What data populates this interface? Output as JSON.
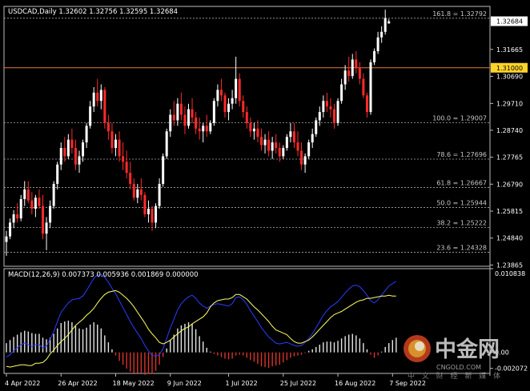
{
  "chart_data": {
    "type": "candlestick",
    "symbol_header": "USDCAD,Daily  1.32602 1.32756 1.32595 1.32684",
    "colors": {
      "up": "#ffffff",
      "down": "#ff2a2a",
      "background": "#000000",
      "grid_dotted": "#aaaaaa",
      "resistance": "#e07a3a",
      "macd_line": "#2b3cff",
      "signal_line": "#ffff66",
      "hist_positive": "#e6e6e6",
      "hist_negative": "#d8342a",
      "current_price_box": "#ffffff",
      "level_box": "#ffd42a"
    },
    "price_axis": {
      "ylim": [
        1.2382,
        1.3322
      ],
      "ticks": [
        "1.31665",
        "1.30690",
        "1.29710",
        "1.28740",
        "1.27765",
        "1.26790",
        "1.25815",
        "1.24840",
        "1.23865"
      ]
    },
    "current_price": "1.32684",
    "horizontal_level": {
      "value": 1.31,
      "label": "1.31000"
    },
    "fibonacci": [
      {
        "label": "161.8 = 1.32792",
        "value": 1.32792
      },
      {
        "label": "100.0 = 1.29007",
        "value": 1.29007
      },
      {
        "label": "78.6 = 1.27696",
        "value": 1.27696
      },
      {
        "label": "61.8 = 1.26667",
        "value": 1.26667
      },
      {
        "label": "50.0 = 1.25944",
        "value": 1.25944
      },
      {
        "label": "38.2 = 1.25222",
        "value": 1.25222
      },
      {
        "label": "23.6 = 1.24328",
        "value": 1.24328
      }
    ],
    "x_labels": [
      "4 Apr 2022",
      "26 Apr 2022",
      "18 May 2022",
      "9 Jun 2022",
      "1 Jul 2022",
      "25 Jul 2022",
      "16 Aug 2022",
      "7 Sep 2022"
    ],
    "candles": [
      [
        1.247,
        1.251,
        1.242,
        1.249
      ],
      [
        1.249,
        1.2555,
        1.248,
        1.254
      ],
      [
        1.254,
        1.2585,
        1.252,
        1.257
      ],
      [
        1.257,
        1.261,
        1.254,
        1.2555
      ],
      [
        1.2555,
        1.264,
        1.2545,
        1.2625
      ],
      [
        1.2625,
        1.269,
        1.26,
        1.266
      ],
      [
        1.266,
        1.269,
        1.261,
        1.262
      ],
      [
        1.262,
        1.265,
        1.257,
        1.259
      ],
      [
        1.259,
        1.264,
        1.256,
        1.263
      ],
      [
        1.263,
        1.266,
        1.259,
        1.26
      ],
      [
        1.26,
        1.264,
        1.248,
        1.25
      ],
      [
        1.25,
        1.256,
        1.244,
        1.254
      ],
      [
        1.254,
        1.262,
        1.252,
        1.26
      ],
      [
        1.26,
        1.269,
        1.259,
        1.268
      ],
      [
        1.268,
        1.276,
        1.266,
        1.275
      ],
      [
        1.275,
        1.283,
        1.273,
        1.281
      ],
      [
        1.281,
        1.285,
        1.276,
        1.278
      ],
      [
        1.278,
        1.286,
        1.277,
        1.284
      ],
      [
        1.284,
        1.288,
        1.279,
        1.281
      ],
      [
        1.281,
        1.284,
        1.273,
        1.275
      ],
      [
        1.275,
        1.28,
        1.272,
        1.278
      ],
      [
        1.278,
        1.284,
        1.276,
        1.283
      ],
      [
        1.283,
        1.29,
        1.281,
        1.289
      ],
      [
        1.289,
        1.298,
        1.288,
        1.296
      ],
      [
        1.296,
        1.303,
        1.294,
        1.301
      ],
      [
        1.301,
        1.306,
        1.296,
        1.298
      ],
      [
        1.298,
        1.304,
        1.295,
        1.302
      ],
      [
        1.302,
        1.303,
        1.288,
        1.29
      ],
      [
        1.29,
        1.293,
        1.284,
        1.287
      ],
      [
        1.287,
        1.29,
        1.279,
        1.281
      ],
      [
        1.281,
        1.286,
        1.278,
        1.284
      ],
      [
        1.284,
        1.287,
        1.276,
        1.278
      ],
      [
        1.278,
        1.283,
        1.273,
        1.276
      ],
      [
        1.276,
        1.28,
        1.27,
        1.272
      ],
      [
        1.272,
        1.276,
        1.266,
        1.268
      ],
      [
        1.268,
        1.27,
        1.262,
        1.263
      ],
      [
        1.263,
        1.268,
        1.261,
        1.266
      ],
      [
        1.266,
        1.27,
        1.262,
        1.264
      ],
      [
        1.264,
        1.265,
        1.256,
        1.257
      ],
      [
        1.257,
        1.262,
        1.254,
        1.259
      ],
      [
        1.259,
        1.26,
        1.251,
        1.254
      ],
      [
        1.254,
        1.261,
        1.252,
        1.26
      ],
      [
        1.26,
        1.27,
        1.259,
        1.268
      ],
      [
        1.268,
        1.279,
        1.267,
        1.278
      ],
      [
        1.278,
        1.288,
        1.277,
        1.287
      ],
      [
        1.287,
        1.295,
        1.285,
        1.293
      ],
      [
        1.293,
        1.298,
        1.289,
        1.291
      ],
      [
        1.291,
        1.299,
        1.289,
        1.297
      ],
      [
        1.297,
        1.301,
        1.291,
        1.293
      ],
      [
        1.293,
        1.296,
        1.286,
        1.289
      ],
      [
        1.289,
        1.297,
        1.288,
        1.295
      ],
      [
        1.295,
        1.299,
        1.29,
        1.292
      ],
      [
        1.292,
        1.294,
        1.286,
        1.288
      ],
      [
        1.288,
        1.292,
        1.284,
        1.287
      ],
      [
        1.287,
        1.29,
        1.283,
        1.289
      ],
      [
        1.289,
        1.293,
        1.285,
        1.287
      ],
      [
        1.287,
        1.291,
        1.286,
        1.29
      ],
      [
        1.29,
        1.299,
        1.289,
        1.298
      ],
      [
        1.298,
        1.304,
        1.296,
        1.302
      ],
      [
        1.302,
        1.306,
        1.298,
        1.3
      ],
      [
        1.3,
        1.301,
        1.292,
        1.294
      ],
      [
        1.294,
        1.299,
        1.291,
        1.297
      ],
      [
        1.297,
        1.302,
        1.295,
        1.299
      ],
      [
        1.299,
        1.314,
        1.297,
        1.306
      ],
      [
        1.306,
        1.308,
        1.296,
        1.298
      ],
      [
        1.298,
        1.3,
        1.292,
        1.294
      ],
      [
        1.294,
        1.296,
        1.288,
        1.29
      ],
      [
        1.29,
        1.292,
        1.285,
        1.287
      ],
      [
        1.287,
        1.29,
        1.284,
        1.288
      ],
      [
        1.288,
        1.291,
        1.283,
        1.285
      ],
      [
        1.285,
        1.288,
        1.28,
        1.282
      ],
      [
        1.282,
        1.286,
        1.279,
        1.284
      ],
      [
        1.284,
        1.287,
        1.278,
        1.28
      ],
      [
        1.28,
        1.285,
        1.277,
        1.283
      ],
      [
        1.283,
        1.286,
        1.279,
        1.281
      ],
      [
        1.281,
        1.283,
        1.276,
        1.278
      ],
      [
        1.278,
        1.282,
        1.277,
        1.281
      ],
      [
        1.281,
        1.286,
        1.28,
        1.285
      ],
      [
        1.285,
        1.29,
        1.283,
        1.287
      ],
      [
        1.287,
        1.29,
        1.281,
        1.283
      ],
      [
        1.283,
        1.287,
        1.278,
        1.28
      ],
      [
        1.28,
        1.283,
        1.273,
        1.275
      ],
      [
        1.275,
        1.279,
        1.272,
        1.278
      ],
      [
        1.278,
        1.284,
        1.277,
        1.283
      ],
      [
        1.283,
        1.288,
        1.281,
        1.286
      ],
      [
        1.286,
        1.292,
        1.285,
        1.291
      ],
      [
        1.291,
        1.296,
        1.289,
        1.294
      ],
      [
        1.294,
        1.3,
        1.292,
        1.298
      ],
      [
        1.298,
        1.301,
        1.294,
        1.296
      ],
      [
        1.296,
        1.299,
        1.292,
        1.295
      ],
      [
        1.295,
        1.297,
        1.288,
        1.29
      ],
      [
        1.29,
        1.299,
        1.289,
        1.298
      ],
      [
        1.298,
        1.306,
        1.297,
        1.304
      ],
      [
        1.304,
        1.311,
        1.302,
        1.309
      ],
      [
        1.309,
        1.314,
        1.305,
        1.307
      ],
      [
        1.307,
        1.315,
        1.306,
        1.313
      ],
      [
        1.313,
        1.316,
        1.308,
        1.31
      ],
      [
        1.31,
        1.312,
        1.304,
        1.306
      ],
      [
        1.306,
        1.308,
        1.299,
        1.3
      ],
      [
        1.3,
        1.301,
        1.292,
        1.294
      ],
      [
        1.294,
        1.313,
        1.293,
        1.312
      ],
      [
        1.312,
        1.317,
        1.311,
        1.316
      ],
      [
        1.316,
        1.323,
        1.315,
        1.321
      ],
      [
        1.321,
        1.325,
        1.319,
        1.323
      ],
      [
        1.323,
        1.331,
        1.322,
        1.328
      ],
      [
        1.326,
        1.3276,
        1.326,
        1.3268
      ]
    ],
    "macd": {
      "header": "MACD(12,26,9) 0.007373 0.005936 0.001869 0.000000",
      "ylim": [
        -0.00272,
        0.010838
      ],
      "ticks": [
        "0.010838",
        "0.00",
        "-0.002072"
      ],
      "histogram": [
        0.0012,
        0.0016,
        0.002,
        0.0023,
        0.0026,
        0.0028,
        0.0027,
        0.0025,
        0.0024,
        0.0024,
        0.0019,
        0.0017,
        0.0019,
        0.0024,
        0.0031,
        0.0038,
        0.004,
        0.0041,
        0.0039,
        0.0034,
        0.0031,
        0.003,
        0.0032,
        0.0036,
        0.0039,
        0.0036,
        0.0031,
        0.0022,
        0.0013,
        0.0004,
        -0.0004,
        -0.0011,
        -0.0016,
        -0.0021,
        -0.0025,
        -0.0027,
        -0.0027,
        -0.0027,
        -0.0029,
        -0.0028,
        -0.0028,
        -0.0024,
        -0.0016,
        -0.0006,
        0.0005,
        0.0016,
        0.0023,
        0.0031,
        0.0035,
        0.0037,
        0.0039,
        0.0037,
        0.003,
        0.0021,
        0.0014,
        0.0006,
        0.0001,
        -0.0002,
        -0.0004,
        -0.0006,
        -0.0008,
        -0.0009,
        -0.0008,
        -0.0004,
        -0.0003,
        -0.0004,
        -0.0007,
        -0.001,
        -0.0012,
        -0.0015,
        -0.0018,
        -0.0019,
        -0.002,
        -0.0018,
        -0.0017,
        -0.0016,
        -0.0013,
        -0.001,
        -0.0007,
        -0.0005,
        -0.0004,
        -0.0003,
        -0.0001,
        0.0002,
        0.0004,
        0.0007,
        0.001,
        0.0013,
        0.0014,
        0.0014,
        0.0013,
        0.0015,
        0.0018,
        0.0021,
        0.0023,
        0.0024,
        0.0022,
        0.0018,
        0.0012,
        0.0004,
        -0.0003,
        -0.0007,
        -0.0004,
        0.0001,
        0.0007,
        0.0012,
        0.0016,
        0.0019
      ],
      "macd_line": [
        -0.0006,
        -0.0003,
        0.0002,
        0.0006,
        0.001,
        0.0012,
        0.001,
        0.0008,
        0.001,
        0.001,
        0.0006,
        0.0008,
        0.0017,
        0.0027,
        0.004,
        0.0052,
        0.0058,
        0.0064,
        0.0068,
        0.0069,
        0.007,
        0.0073,
        0.008,
        0.0088,
        0.0096,
        0.01,
        0.0101,
        0.0097,
        0.0091,
        0.0083,
        0.0076,
        0.0067,
        0.0058,
        0.0049,
        0.004,
        0.0032,
        0.0025,
        0.0018,
        0.0009,
        0.0002,
        -0.0004,
        -0.0005,
        -0.0003,
        0.0005,
        0.0018,
        0.0032,
        0.0043,
        0.0055,
        0.0063,
        0.0068,
        0.0072,
        0.0074,
        0.007,
        0.0064,
        0.006,
        0.0057,
        0.006,
        0.0062,
        0.0063,
        0.0062,
        0.0061,
        0.006,
        0.0063,
        0.0071,
        0.0072,
        0.0068,
        0.0062,
        0.0054,
        0.0047,
        0.004,
        0.0032,
        0.0026,
        0.002,
        0.0016,
        0.0012,
        0.0011,
        0.0012,
        0.0013,
        0.0011,
        0.0009,
        0.0008,
        0.0009,
        0.0013,
        0.0018,
        0.0024,
        0.0032,
        0.004,
        0.0048,
        0.0054,
        0.0059,
        0.0062,
        0.0066,
        0.0071,
        0.0077,
        0.0082,
        0.0086,
        0.0087,
        0.0085,
        0.008,
        0.0074,
        0.0067,
        0.0064,
        0.0068,
        0.0074,
        0.008,
        0.0086,
        0.0089,
        0.0092
      ],
      "signal_line": [
        -0.0018,
        -0.0019,
        -0.0018,
        -0.0017,
        -0.0016,
        -0.0016,
        -0.0017,
        -0.0017,
        -0.0014,
        -0.0014,
        -0.0013,
        -0.0009,
        -0.0002,
        0.0003,
        0.0009,
        0.0014,
        0.0018,
        0.0023,
        0.0029,
        0.0035,
        0.0039,
        0.0043,
        0.0048,
        0.0052,
        0.0057,
        0.0064,
        0.007,
        0.0075,
        0.0078,
        0.0079,
        0.008,
        0.0078,
        0.0074,
        0.007,
        0.0065,
        0.0059,
        0.0052,
        0.0045,
        0.0038,
        0.003,
        0.0024,
        0.0019,
        0.0013,
        0.0011,
        0.0013,
        0.0016,
        0.002,
        0.0024,
        0.0028,
        0.0031,
        0.0033,
        0.0037,
        0.004,
        0.0043,
        0.0046,
        0.0051,
        0.0059,
        0.0064,
        0.0067,
        0.0068,
        0.0069,
        0.0069,
        0.0071,
        0.0075,
        0.0075,
        0.0072,
        0.0069,
        0.0064,
        0.0059,
        0.0055,
        0.005,
        0.0045,
        0.004,
        0.0034,
        0.0029,
        0.0027,
        0.0025,
        0.0023,
        0.0018,
        0.0014,
        0.0012,
        0.0012,
        0.0014,
        0.0016,
        0.002,
        0.0025,
        0.003,
        0.0035,
        0.004,
        0.0045,
        0.0049,
        0.0051,
        0.0053,
        0.0056,
        0.0059,
        0.0062,
        0.0065,
        0.0067,
        0.0068,
        0.007,
        0.007,
        0.0071,
        0.0072,
        0.0073,
        0.0073,
        0.0074,
        0.0073,
        0.0073
      ]
    }
  },
  "watermark": {
    "name": "中金网",
    "domain": "CNGOLD.COM",
    "tagline": "中 文 财 经 新 媒 体"
  }
}
